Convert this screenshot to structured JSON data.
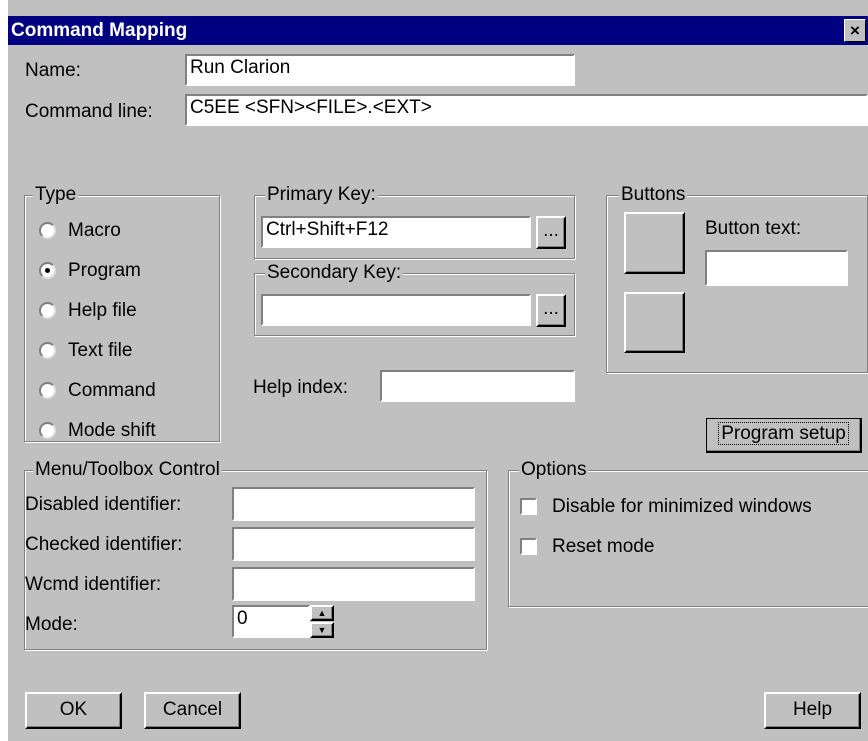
{
  "window": {
    "title": "Command Mapping",
    "close_glyph": "×"
  },
  "name": {
    "label": "Name:",
    "value": "Run Clarion"
  },
  "command_line": {
    "label": "Command line:",
    "value": "C5EE <SFN><FILE>.<EXT>"
  },
  "type_group": {
    "legend": "Type",
    "options": [
      {
        "label": "Macro",
        "selected": false
      },
      {
        "label": "Program",
        "selected": true
      },
      {
        "label": "Help file",
        "selected": false
      },
      {
        "label": "Text file",
        "selected": false
      },
      {
        "label": "Command",
        "selected": false
      },
      {
        "label": "Mode shift",
        "selected": false
      }
    ]
  },
  "primary_key": {
    "legend": "Primary Key:",
    "value": "Ctrl+Shift+F12",
    "browse_label": "..."
  },
  "secondary_key": {
    "legend": "Secondary Key:",
    "value": "",
    "browse_label": "..."
  },
  "help_index": {
    "label": "Help index:",
    "value": ""
  },
  "buttons_group": {
    "legend": "Buttons",
    "button_text_label": "Button text:",
    "button_text_value": ""
  },
  "program_setup_label": "Program setup",
  "menu_toolbox": {
    "legend": "Menu/Toolbox Control",
    "disabled_label": "Disabled identifier:",
    "disabled_value": "",
    "checked_label": "Checked identifier:",
    "checked_value": "",
    "wcmd_label": "Wcmd identifier:",
    "wcmd_value": "",
    "mode_label": "Mode:",
    "mode_value": "0"
  },
  "options_group": {
    "legend": "Options",
    "disable_minimized_label": "Disable for minimized windows",
    "disable_minimized_checked": false,
    "reset_mode_label": "Reset mode",
    "reset_mode_checked": false
  },
  "footer": {
    "ok_label": "OK",
    "cancel_label": "Cancel",
    "help_label": "Help"
  }
}
